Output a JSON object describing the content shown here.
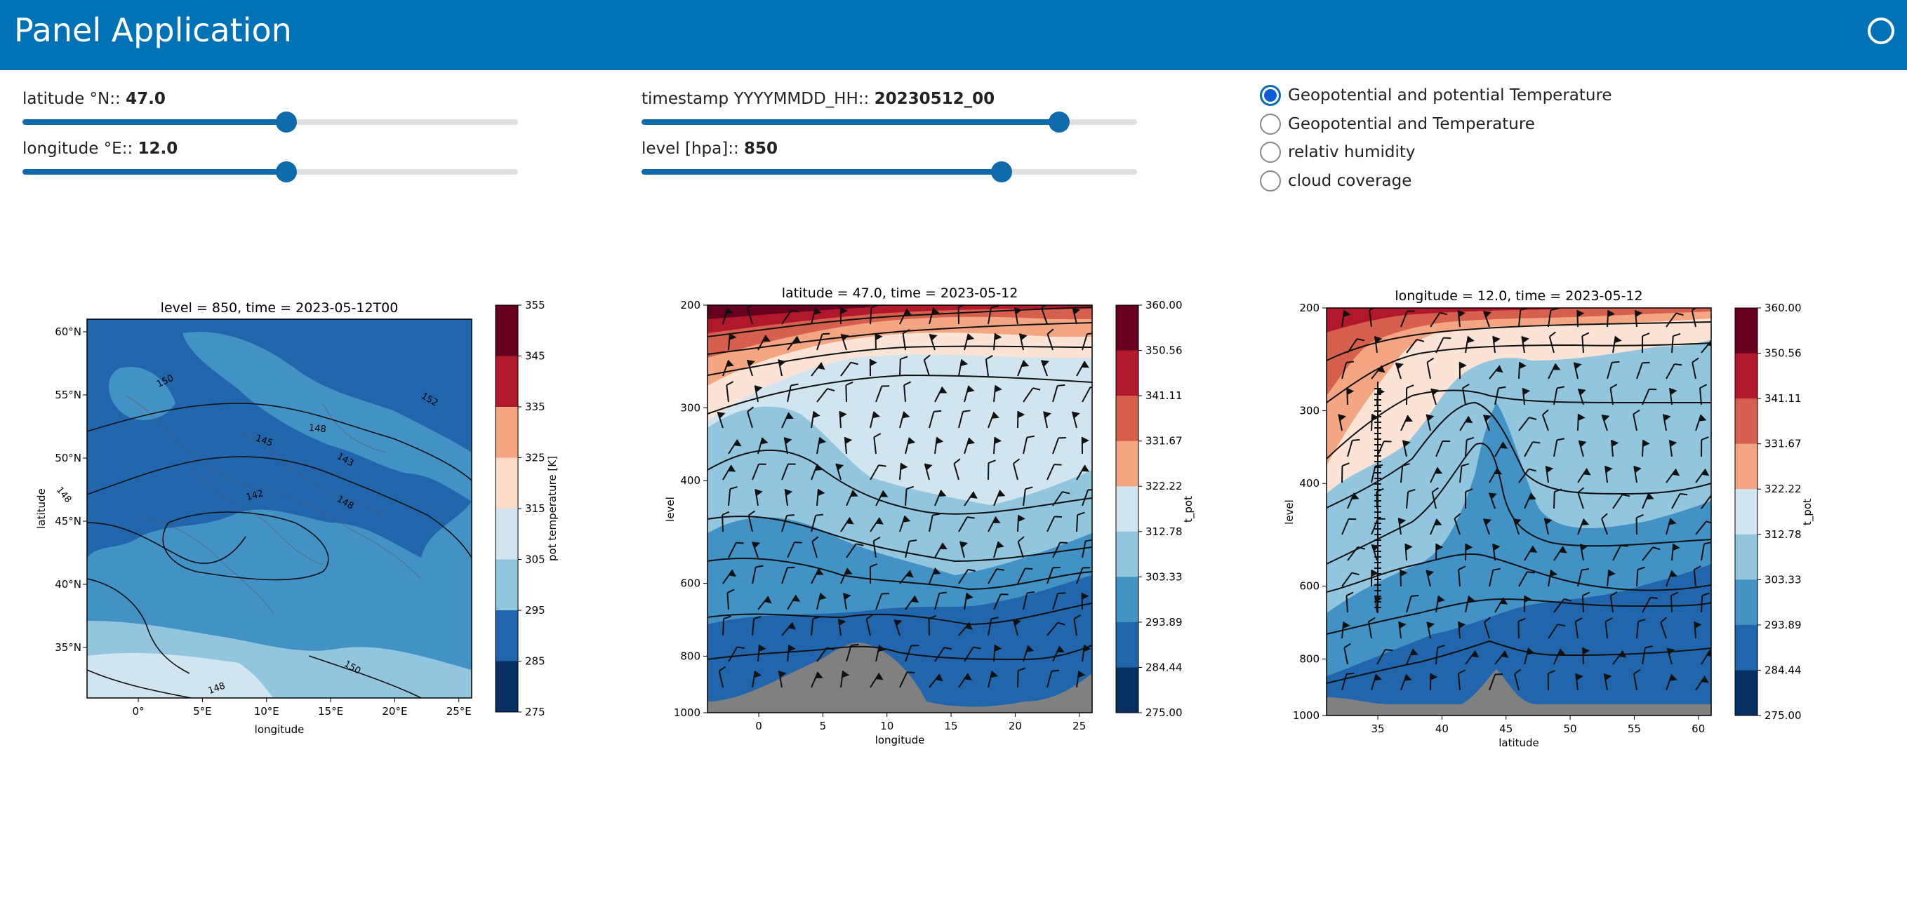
{
  "app": {
    "title": "Panel Application"
  },
  "controls": {
    "latitude": {
      "label": "latitude °N::",
      "value": "47.0",
      "fraction": 0.533
    },
    "longitude": {
      "label": "longitude °E::",
      "value": "12.0",
      "fraction": 0.533
    },
    "timestamp": {
      "label": "timestamp YYYYMMDD_HH::",
      "value": "20230512_00",
      "fraction": 0.843
    },
    "level": {
      "label": "level [hpa]::",
      "value": "850",
      "fraction": 0.727
    }
  },
  "radio_group": {
    "options": [
      "Geopotential and potential Temperature",
      "Geopotential and Temperature",
      "relativ humidity",
      "cloud coverage"
    ],
    "selected_index": 0
  },
  "chart_data": [
    {
      "type": "heatmap",
      "title": "level = 850, time = 2023-05-12T00",
      "xlabel": "longitude",
      "ylabel": "latitude",
      "x_ticks": [
        "0°",
        "5°E",
        "10°E",
        "15°E",
        "20°E",
        "25°E"
      ],
      "y_ticks": [
        "60°N",
        "55°N",
        "50°N",
        "45°N",
        "40°N",
        "35°N"
      ],
      "xlim": [
        -4,
        26
      ],
      "ylim": [
        31,
        61
      ],
      "colorbar": {
        "label": "pot temperature [K]",
        "ticks": [
          "355",
          "345",
          "335",
          "325",
          "315",
          "305",
          "295",
          "285",
          "275"
        ]
      },
      "contour_labels": [
        "150",
        "148",
        "145",
        "142",
        "148",
        "152",
        "143",
        "148",
        "150",
        "148"
      ]
    },
    {
      "type": "heatmap",
      "title": "latitude = 47.0, time = 2023-05-12",
      "xlabel": "longitude",
      "ylabel": "level",
      "x_ticks": [
        "0",
        "5",
        "10",
        "15",
        "20",
        "25"
      ],
      "y_ticks": [
        "200",
        "300",
        "400",
        "600",
        "800",
        "1000"
      ],
      "xlim": [
        -4,
        26
      ],
      "ylim": [
        1000,
        200
      ],
      "y_scale": "log",
      "colorbar": {
        "label": "t_pot",
        "ticks": [
          "360.00",
          "350.56",
          "341.11",
          "331.67",
          "322.22",
          "312.78",
          "303.33",
          "293.89",
          "284.44",
          "275.00"
        ]
      }
    },
    {
      "type": "heatmap",
      "title": "longitude = 12.0, time = 2023-05-12",
      "xlabel": "latitude",
      "ylabel": "level",
      "x_ticks": [
        "35",
        "40",
        "45",
        "50",
        "55",
        "60"
      ],
      "y_ticks": [
        "200",
        "300",
        "400",
        "600",
        "800",
        "1000"
      ],
      "xlim": [
        31,
        61
      ],
      "ylim": [
        1000,
        200
      ],
      "y_scale": "log",
      "colorbar": {
        "label": "t_pot",
        "ticks": [
          "360.00",
          "350.56",
          "341.11",
          "331.67",
          "322.22",
          "312.78",
          "303.33",
          "293.89",
          "284.44",
          "275.00"
        ]
      }
    }
  ]
}
